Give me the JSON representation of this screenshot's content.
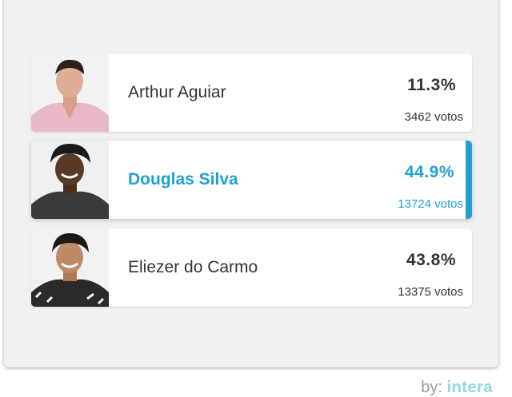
{
  "poll": {
    "candidates": [
      {
        "name": "Arthur Aguiar",
        "percent": "11.3%",
        "votes": "3462 votos",
        "selected": false,
        "photo_icon": "person-photo-icon"
      },
      {
        "name": "Douglas Silva",
        "percent": "44.9%",
        "votes": "13724 votos",
        "selected": true,
        "photo_icon": "person-photo-icon"
      },
      {
        "name": "Eliezer do Carmo",
        "percent": "43.8%",
        "votes": "13375 votos",
        "selected": false,
        "photo_icon": "person-photo-icon"
      }
    ]
  },
  "footer": {
    "by_label": "by:",
    "brand": "intera"
  },
  "colors": {
    "accent": "#1ea2d6",
    "text": "#333333",
    "panel_bg": "#f1f1f1",
    "brand": "#8fd8e3"
  }
}
